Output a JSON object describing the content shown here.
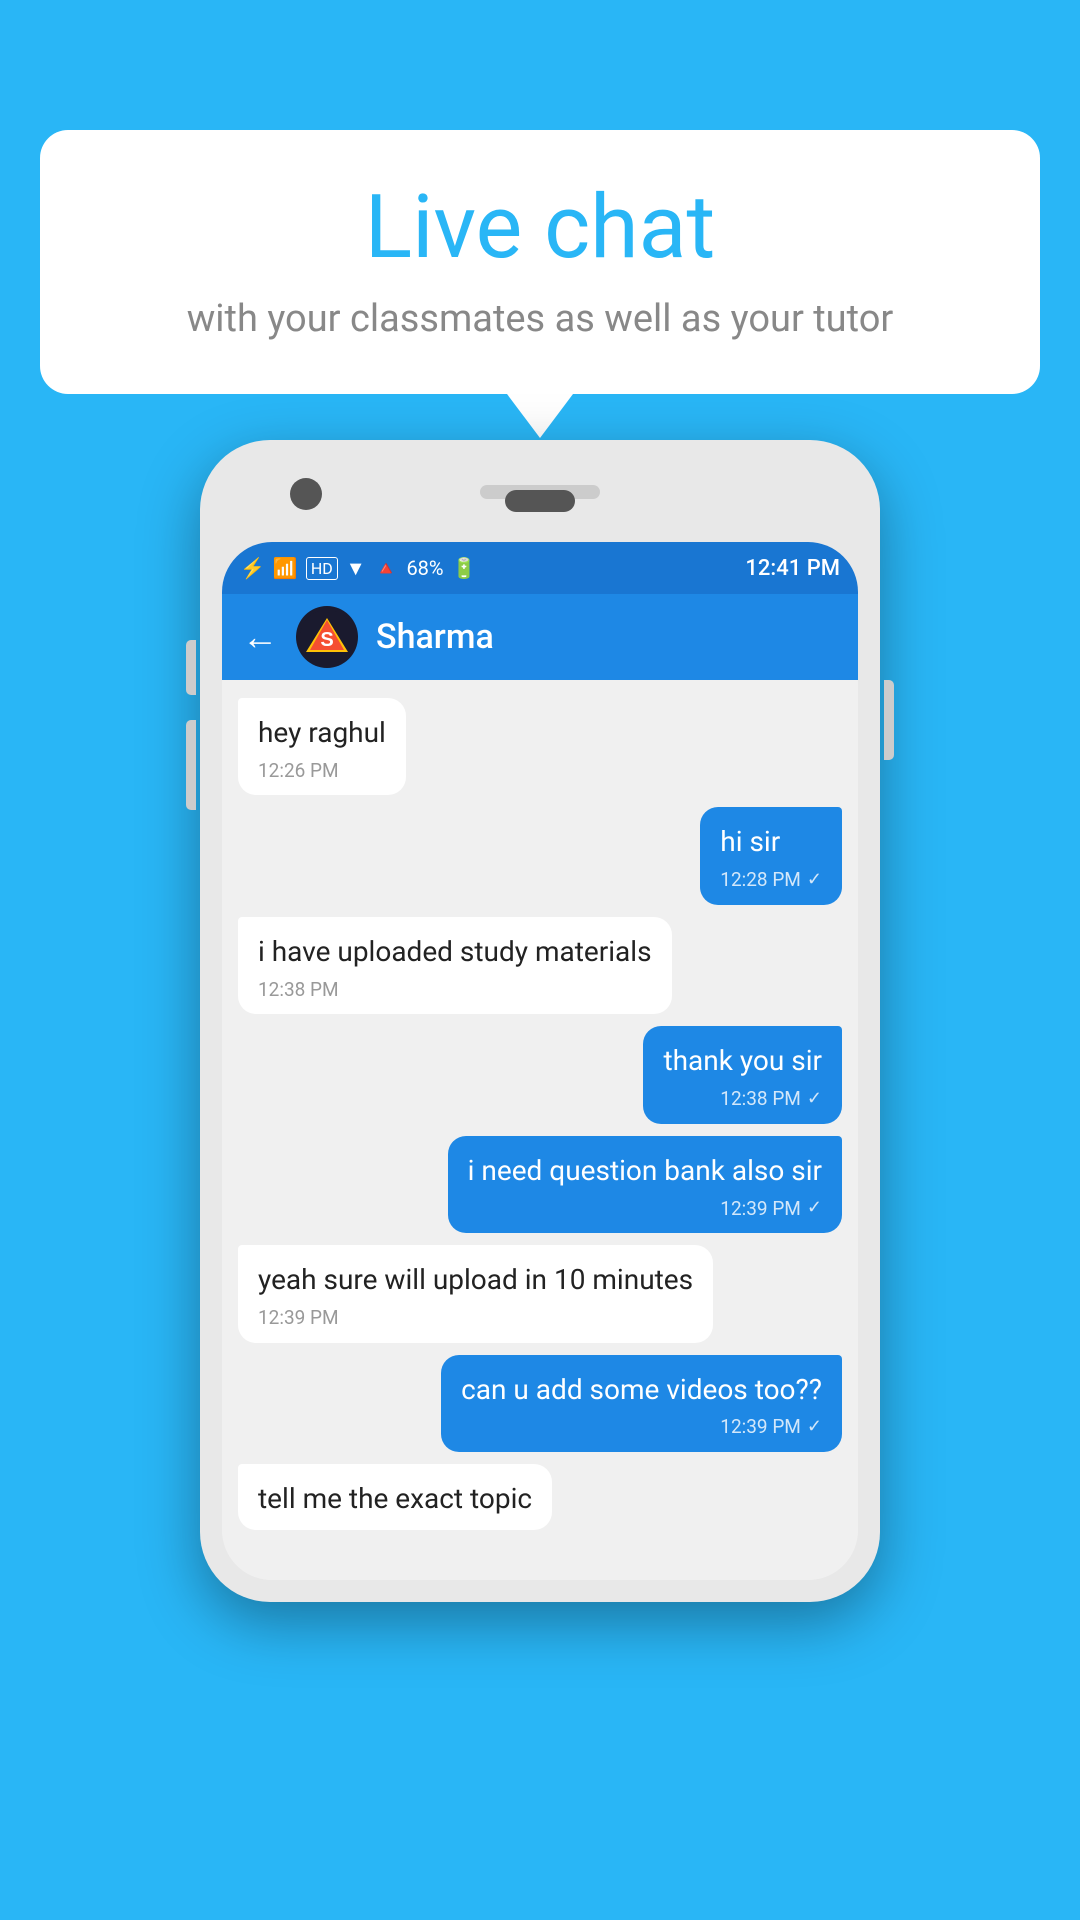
{
  "background_color": "#29b6f6",
  "bubble": {
    "title": "Live chat",
    "subtitle": "with your classmates as well as your tutor"
  },
  "phone": {
    "status_bar": {
      "time": "12:41 PM",
      "battery": "68%",
      "signal_icons": "🔵📶📡"
    },
    "chat_header": {
      "back_label": "←",
      "contact_name": "Sharma",
      "avatar_label": "S"
    },
    "messages": [
      {
        "id": "msg1",
        "type": "received",
        "text": "hey raghul",
        "time": "12:26 PM",
        "has_check": false
      },
      {
        "id": "msg2",
        "type": "sent",
        "text": "hi sir",
        "time": "12:28 PM",
        "has_check": true
      },
      {
        "id": "msg3",
        "type": "received",
        "text": "i have uploaded study materials",
        "time": "12:38 PM",
        "has_check": false
      },
      {
        "id": "msg4",
        "type": "sent",
        "text": "thank you sir",
        "time": "12:38 PM",
        "has_check": true
      },
      {
        "id": "msg5",
        "type": "sent",
        "text": "i need question bank also sir",
        "time": "12:39 PM",
        "has_check": true
      },
      {
        "id": "msg6",
        "type": "received",
        "text": "yeah sure will upload in 10 minutes",
        "time": "12:39 PM",
        "has_check": false
      },
      {
        "id": "msg7",
        "type": "sent",
        "text": "can u add some videos too??",
        "time": "12:39 PM",
        "has_check": true
      },
      {
        "id": "msg8",
        "type": "received",
        "text": "tell me the exact topic",
        "time": "",
        "has_check": false,
        "partial": true
      }
    ]
  }
}
